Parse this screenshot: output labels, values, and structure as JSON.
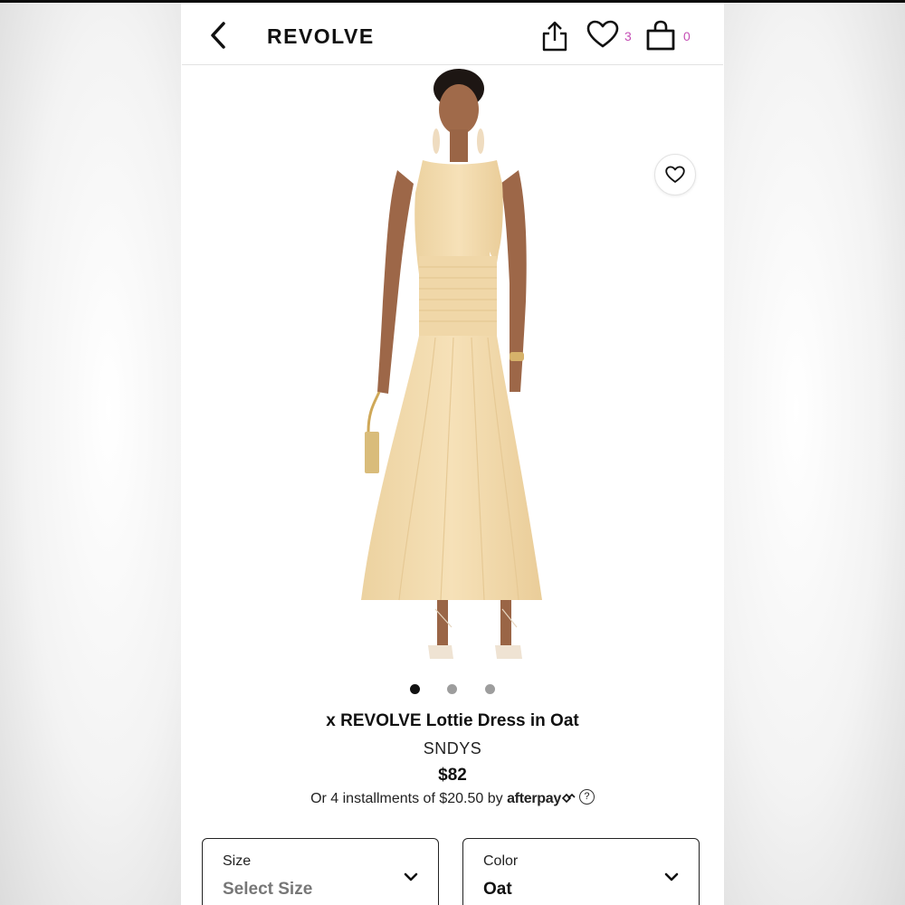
{
  "header": {
    "logo": "REVOLVE",
    "wishlist_count": "3",
    "bag_count": "0"
  },
  "icons": {
    "back": "chevron-left-icon",
    "share": "share-icon",
    "wishlist": "heart-icon",
    "bag": "shopping-bag-icon",
    "favorite": "heart-icon",
    "help": "question-circle-icon",
    "dropdown": "chevron-down-icon"
  },
  "gallery": {
    "dots": [
      {
        "active": true
      },
      {
        "active": false
      },
      {
        "active": false
      }
    ]
  },
  "product": {
    "name": "x REVOLVE Lottie Dress in Oat",
    "brand": "SNDYS",
    "price": "$82",
    "installment_text": "Or 4 installments of $20.50 by",
    "afterpay_label": "afterpay",
    "help_symbol": "?"
  },
  "size_select": {
    "label": "Size",
    "value": "Select Size"
  },
  "color_select": {
    "label": "Color",
    "value": "Oat"
  },
  "colors": {
    "badge": "#c54fb5",
    "dress": "#f2dcae"
  }
}
